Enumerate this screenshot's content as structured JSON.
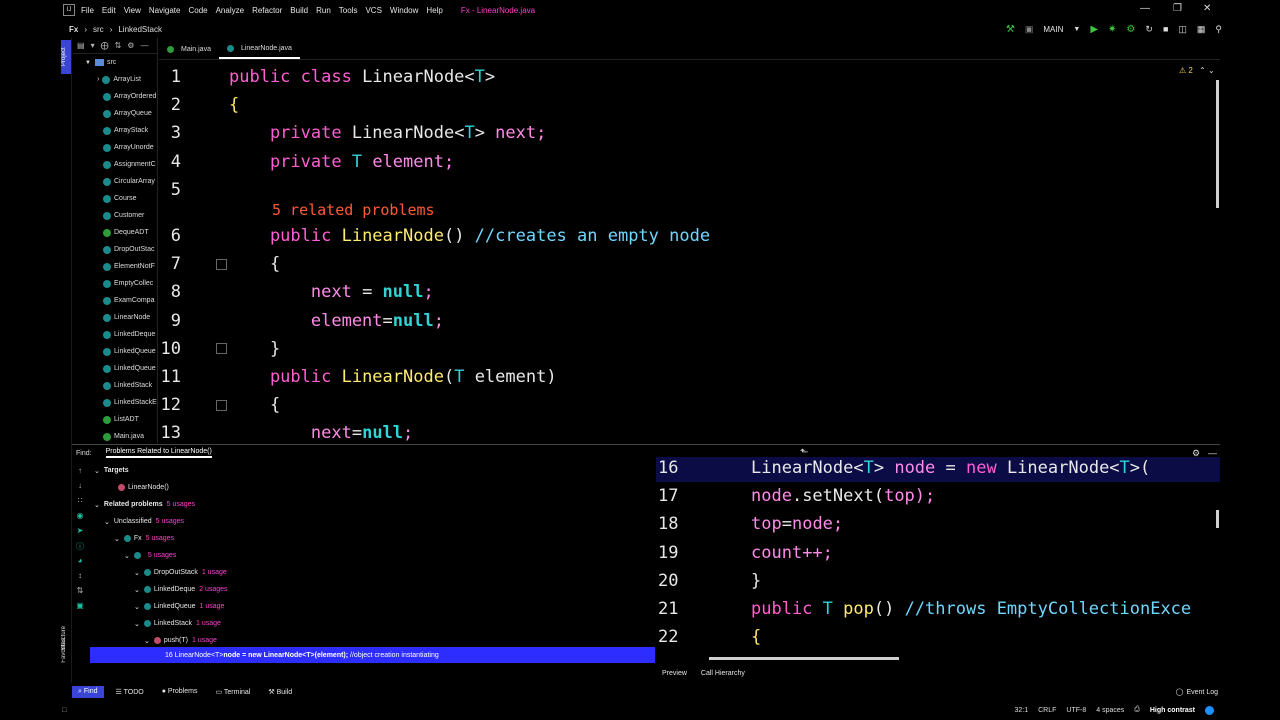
{
  "menu": {
    "items": [
      "File",
      "Edit",
      "View",
      "Navigate",
      "Code",
      "Analyze",
      "Refactor",
      "Build",
      "Run",
      "Tools",
      "VCS",
      "Window",
      "Help"
    ],
    "title": "Fx - LinearNode.java",
    "logo": "IJ"
  },
  "breadcrumb": [
    "Fx",
    "src",
    "LinkedStack"
  ],
  "toolbar": {
    "run_config": "MAIN"
  },
  "left_strip": {
    "project": "Project",
    "structure": "Structure",
    "favorites": "Favorites"
  },
  "project": {
    "root": "src",
    "items": [
      {
        "label": "ArrayList",
        "type": "folder"
      },
      {
        "label": "ArrayOrdered",
        "type": "class"
      },
      {
        "label": "ArrayQueue",
        "type": "class"
      },
      {
        "label": "ArrayStack",
        "type": "class"
      },
      {
        "label": "ArrayUnorde",
        "type": "class"
      },
      {
        "label": "AssignmentC",
        "type": "class"
      },
      {
        "label": "CircularArray",
        "type": "class"
      },
      {
        "label": "Course",
        "type": "class"
      },
      {
        "label": "Customer",
        "type": "class"
      },
      {
        "label": "DequeADT",
        "type": "interface"
      },
      {
        "label": "DropOutStac",
        "type": "class"
      },
      {
        "label": "ElementNotF",
        "type": "class"
      },
      {
        "label": "EmptyCollec",
        "type": "class"
      },
      {
        "label": "ExamCompa",
        "type": "class"
      },
      {
        "label": "LinearNode",
        "type": "class"
      },
      {
        "label": "LinkedDeque",
        "type": "class"
      },
      {
        "label": "LinkedQueue",
        "type": "class"
      },
      {
        "label": "LinkedQueue",
        "type": "class"
      },
      {
        "label": "LinkedStack",
        "type": "class"
      },
      {
        "label": "LinkedStackE",
        "type": "class"
      },
      {
        "label": "ListADT",
        "type": "interface"
      },
      {
        "label": "Main.java",
        "type": "file"
      }
    ]
  },
  "tabs": [
    {
      "label": "Main.java",
      "active": false
    },
    {
      "label": "LinearNode.java",
      "active": true
    }
  ],
  "editor": {
    "inspection_count": "2",
    "related_problems": "5 related problems",
    "lines": [
      {
        "n": "1",
        "tokens": [
          {
            "t": "public class ",
            "c": "kw"
          },
          {
            "t": "LinearNode",
            "c": "pl"
          },
          {
            "t": "<",
            "c": "pl"
          },
          {
            "t": "T",
            "c": "ty"
          },
          {
            "t": ">",
            "c": "pl"
          }
        ]
      },
      {
        "n": "2",
        "tokens": [
          {
            "t": "{",
            "c": "brace"
          }
        ]
      },
      {
        "n": "3",
        "tokens": [
          {
            "t": "    private ",
            "c": "kw"
          },
          {
            "t": "LinearNode",
            "c": "pl"
          },
          {
            "t": "<",
            "c": "pl"
          },
          {
            "t": "T",
            "c": "ty"
          },
          {
            "t": "> ",
            "c": "pl"
          },
          {
            "t": "next",
            "c": "fld"
          },
          {
            "t": ";",
            "c": "fld"
          }
        ]
      },
      {
        "n": "4",
        "tokens": [
          {
            "t": "    private ",
            "c": "kw"
          },
          {
            "t": "T ",
            "c": "ty"
          },
          {
            "t": "element",
            "c": "fld"
          },
          {
            "t": ";",
            "c": "fld"
          }
        ]
      },
      {
        "n": "5",
        "tokens": []
      },
      {
        "n": "6",
        "tokens": [
          {
            "t": "    public ",
            "c": "kw"
          },
          {
            "t": "LinearNode",
            "c": "fn"
          },
          {
            "t": "() ",
            "c": "pl"
          },
          {
            "t": "//creates an empty node",
            "c": "cm"
          }
        ]
      },
      {
        "n": "7",
        "tokens": [
          {
            "t": "    {",
            "c": "pl"
          }
        ]
      },
      {
        "n": "8",
        "tokens": [
          {
            "t": "        next",
            "c": "fld"
          },
          {
            "t": " = ",
            "c": "pl"
          },
          {
            "t": "null",
            "c": "lit"
          },
          {
            "t": ";",
            "c": "fld"
          }
        ]
      },
      {
        "n": "9",
        "tokens": [
          {
            "t": "        element",
            "c": "fld"
          },
          {
            "t": "=",
            "c": "pl"
          },
          {
            "t": "null",
            "c": "lit"
          },
          {
            "t": ";",
            "c": "fld"
          }
        ]
      },
      {
        "n": "10",
        "tokens": [
          {
            "t": "    }",
            "c": "pl"
          }
        ]
      },
      {
        "n": "11",
        "tokens": [
          {
            "t": "    public ",
            "c": "kw"
          },
          {
            "t": "LinearNode",
            "c": "fn"
          },
          {
            "t": "(",
            "c": "pl"
          },
          {
            "t": "T ",
            "c": "ty"
          },
          {
            "t": "element)",
            "c": "pl"
          }
        ]
      },
      {
        "n": "12",
        "tokens": [
          {
            "t": "    {",
            "c": "pl"
          }
        ]
      },
      {
        "n": "13",
        "tokens": [
          {
            "t": "        next",
            "c": "fld"
          },
          {
            "t": "=",
            "c": "pl"
          },
          {
            "t": "null",
            "c": "lit"
          },
          {
            "t": ";",
            "c": "fld"
          }
        ]
      }
    ]
  },
  "find": {
    "label": "Find:",
    "tab": "Problems Related to LinearNode()",
    "rows": [
      {
        "label": "Targets",
        "usage": "",
        "depth": 0,
        "bold": true
      },
      {
        "label": "LinearNode()",
        "usage": "",
        "depth": 2,
        "bold": false
      },
      {
        "label": "Related problems",
        "usage": "5 usages",
        "depth": 0,
        "bold": true
      },
      {
        "label": "Unclassified",
        "usage": "5 usages",
        "depth": 1,
        "bold": false
      },
      {
        "label": "Fx",
        "usage": "5 usages",
        "depth": 2,
        "bold": false
      },
      {
        "label": "",
        "usage": "5 usages",
        "depth": 3,
        "bold": false
      },
      {
        "label": "DropOutStack",
        "usage": "1 usage",
        "depth": 4,
        "bold": false
      },
      {
        "label": "LinkedDeque",
        "usage": "2 usages",
        "depth": 4,
        "bold": false
      },
      {
        "label": "LinkedQueue",
        "usage": "1 usage",
        "depth": 4,
        "bold": false
      },
      {
        "label": "LinkedStack",
        "usage": "1 usage",
        "depth": 4,
        "bold": false
      },
      {
        "label": "push(T)",
        "usage": "1 usage",
        "depth": 5,
        "bold": false
      }
    ],
    "selected": {
      "num": "16",
      "pre": "LinearNode<T> ",
      "b1": "node",
      "mid": " = new LinearNode<T>(element);",
      "cmt": " //object creation instantiating"
    }
  },
  "preview": {
    "lines": [
      {
        "n": "16",
        "hl": true,
        "tokens": [
          {
            "t": "LinearNode<",
            "c": "pl"
          },
          {
            "t": "T",
            "c": "ty"
          },
          {
            "t": "> ",
            "c": "pl"
          },
          {
            "t": "node",
            "c": "fld"
          },
          {
            "t": " = ",
            "c": "pl"
          },
          {
            "t": "new ",
            "c": "kw"
          },
          {
            "t": "LinearNode<",
            "c": "pl"
          },
          {
            "t": "T",
            "c": "ty"
          },
          {
            "t": ">(",
            "c": "pl"
          }
        ]
      },
      {
        "n": "17",
        "hl": false,
        "tokens": [
          {
            "t": "node",
            "c": "fld"
          },
          {
            "t": ".setNext(",
            "c": "pl"
          },
          {
            "t": "top",
            "c": "fld"
          },
          {
            "t": ");",
            "c": "fld"
          }
        ]
      },
      {
        "n": "18",
        "hl": false,
        "tokens": [
          {
            "t": "top",
            "c": "fld"
          },
          {
            "t": "=",
            "c": "pl"
          },
          {
            "t": "node",
            "c": "fld"
          },
          {
            "t": ";",
            "c": "fld"
          }
        ]
      },
      {
        "n": "19",
        "hl": false,
        "tokens": [
          {
            "t": "count",
            "c": "fld"
          },
          {
            "t": "++;",
            "c": "fld"
          }
        ]
      },
      {
        "n": "20",
        "hl": false,
        "tokens": [
          {
            "t": "}",
            "c": "pl"
          }
        ]
      },
      {
        "n": "21",
        "hl": false,
        "tokens": [
          {
            "t": "public ",
            "c": "kw"
          },
          {
            "t": "T ",
            "c": "ty"
          },
          {
            "t": "pop",
            "c": "fn"
          },
          {
            "t": "() ",
            "c": "pl"
          },
          {
            "t": "//throws EmptyCollectionExce",
            "c": "cm"
          }
        ]
      },
      {
        "n": "22",
        "hl": false,
        "tokens": [
          {
            "t": "{",
            "c": "brace"
          }
        ]
      }
    ],
    "tabs": [
      "Preview",
      "Call Hierarchy"
    ]
  },
  "bottom_tools": [
    {
      "label": "Find",
      "active": true
    },
    {
      "label": "TODO",
      "active": false
    },
    {
      "label": "Problems",
      "active": false
    },
    {
      "label": "Terminal",
      "active": false
    },
    {
      "label": "Build",
      "active": false
    }
  ],
  "event_log": "Event Log",
  "status": {
    "position": "32:1",
    "line_sep": "CRLF",
    "encoding": "UTF-8",
    "indent": "4 spaces",
    "theme": "High contrast"
  }
}
